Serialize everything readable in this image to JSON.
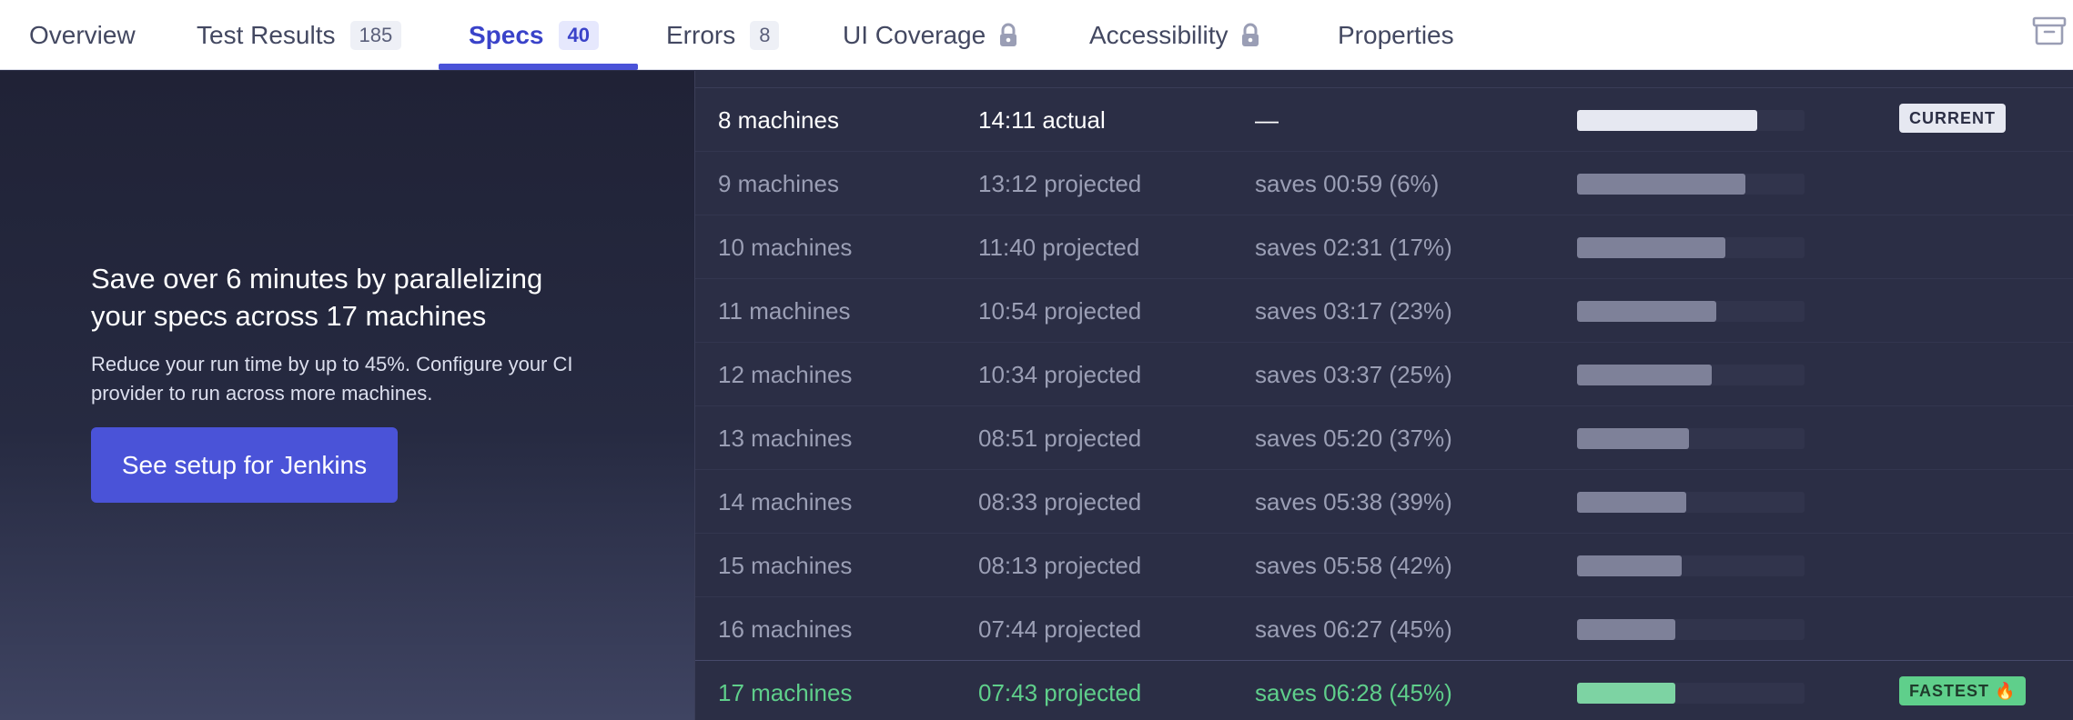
{
  "tabs": [
    {
      "label": "Overview"
    },
    {
      "label": "Test Results",
      "count": "185"
    },
    {
      "label": "Specs",
      "count": "40"
    },
    {
      "label": "Errors",
      "count": "8"
    },
    {
      "label": "UI Coverage"
    },
    {
      "label": "Accessibility"
    },
    {
      "label": "Properties"
    }
  ],
  "promo": {
    "title": "Save over 6 minutes by parallelizing your specs across 17 machines",
    "description": "Reduce your run time by up to 45%. Configure your CI provider to run across more machines.",
    "button_label": "See setup for Jenkins"
  },
  "rows": [
    {
      "machines": "8 machines",
      "time": "14:11 actual",
      "savings": "—",
      "relative_duration": 0.79,
      "badge": "CURRENT"
    },
    {
      "machines": "9 machines",
      "time": "13:12 projected",
      "savings": "saves 00:59 (6%)",
      "relative_duration": 0.74
    },
    {
      "machines": "10 machines",
      "time": "11:40 projected",
      "savings": "saves 02:31 (17%)",
      "relative_duration": 0.65
    },
    {
      "machines": "11 machines",
      "time": "10:54 projected",
      "savings": "saves 03:17 (23%)",
      "relative_duration": 0.61
    },
    {
      "machines": "12 machines",
      "time": "10:34 projected",
      "savings": "saves 03:37 (25%)",
      "relative_duration": 0.59
    },
    {
      "machines": "13 machines",
      "time": "08:51 projected",
      "savings": "saves 05:20 (37%)",
      "relative_duration": 0.49
    },
    {
      "machines": "14 machines",
      "time": "08:33 projected",
      "savings": "saves 05:38 (39%)",
      "relative_duration": 0.48
    },
    {
      "machines": "15 machines",
      "time": "08:13 projected",
      "savings": "saves 05:58 (42%)",
      "relative_duration": 0.46
    },
    {
      "machines": "16 machines",
      "time": "07:44 projected",
      "savings": "saves 06:27 (45%)",
      "relative_duration": 0.43
    },
    {
      "machines": "17 machines",
      "time": "07:43 projected",
      "savings": "saves 06:28 (45%)",
      "relative_duration": 0.43,
      "badge": "FASTEST"
    }
  ],
  "colors": {
    "accent": "#4a53d8",
    "success": "#5fcf8b",
    "panel_bg": "#2b2e45"
  },
  "icons": {
    "lock": "lock-icon",
    "archive": "archive-icon",
    "flame": "flame-icon"
  }
}
